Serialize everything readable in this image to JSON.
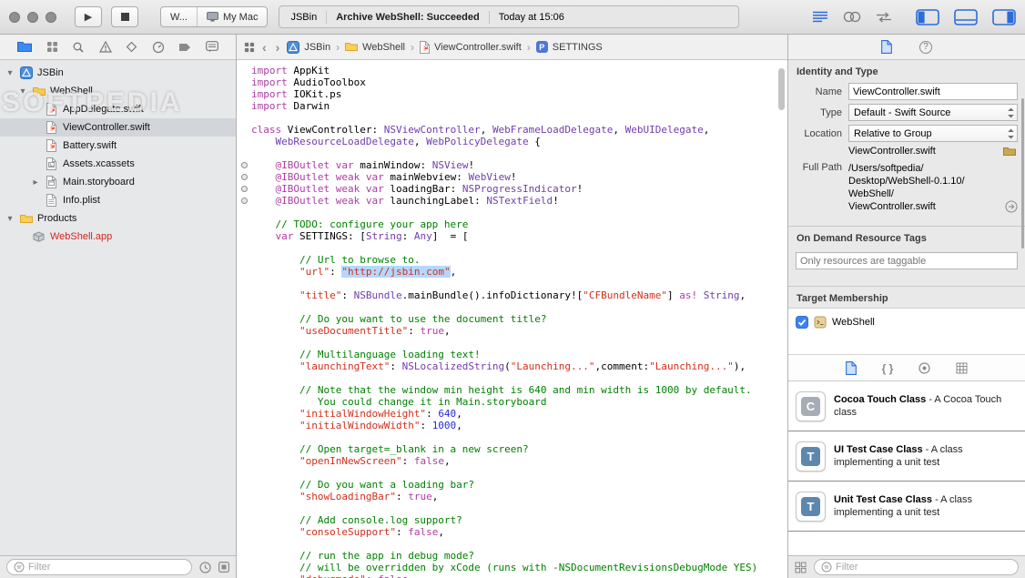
{
  "titlebar": {
    "scheme_label": "W...",
    "destination_label": "My Mac",
    "status_project": "JSBin",
    "status_message": "Archive WebShell: Succeeded",
    "status_time": "Today at 15:06",
    "editor_modes": [
      "standard-editor-icon",
      "assistant-editor-icon",
      "version-editor-icon"
    ],
    "panel_toggles": [
      "toggle-navigator-icon",
      "toggle-debug-area-icon",
      "toggle-utilities-icon"
    ]
  },
  "navigator_tabs": [
    "project-navigator-icon",
    "symbol-navigator-icon",
    "find-navigator-icon",
    "issue-navigator-icon",
    "test-navigator-icon",
    "debug-navigator-icon",
    "breakpoint-navigator-icon",
    "report-navigator-icon"
  ],
  "jumpbar": {
    "crumbs": [
      {
        "icon": "project-icon",
        "label": "JSBin"
      },
      {
        "icon": "folder-icon",
        "label": "WebShell"
      },
      {
        "icon": "swift-file-icon",
        "label": "ViewController.swift"
      },
      {
        "icon": "property-symbol-icon",
        "badge": "P",
        "label": "SETTINGS"
      }
    ]
  },
  "tree": [
    {
      "label": "JSBin",
      "level": 0,
      "icon": "project-icon",
      "disc": "open"
    },
    {
      "label": "WebShell",
      "level": 1,
      "icon": "folder-icon",
      "disc": "open"
    },
    {
      "label": "AppDelegate.swift",
      "level": 2,
      "icon": "swift-file-icon"
    },
    {
      "label": "ViewController.swift",
      "level": 2,
      "icon": "swift-file-icon",
      "selected": true
    },
    {
      "label": "Battery.swift",
      "level": 2,
      "icon": "swift-file-icon"
    },
    {
      "label": "Assets.xcassets",
      "level": 2,
      "icon": "assets-file-icon"
    },
    {
      "label": "Main.storyboard",
      "level": 2,
      "icon": "storyboard-file-icon",
      "disc": "closed"
    },
    {
      "label": "Info.plist",
      "level": 2,
      "icon": "plist-file-icon"
    },
    {
      "label": "Products",
      "level": 0,
      "icon": "folder-icon",
      "disc": "open"
    },
    {
      "label": "WebShell.app",
      "level": 1,
      "icon": "app-icon",
      "missing": true
    }
  ],
  "navigator_filter": {
    "placeholder": "Filter"
  },
  "watermark": "SOFTPEDIA",
  "editor": {
    "lines": [
      {
        "t": [
          [
            "k",
            "import"
          ],
          [
            "p",
            " AppKit"
          ]
        ]
      },
      {
        "t": [
          [
            "k",
            "import"
          ],
          [
            "p",
            " AudioToolbox"
          ]
        ]
      },
      {
        "t": [
          [
            "k",
            "import"
          ],
          [
            "p",
            " IOKit.ps"
          ]
        ]
      },
      {
        "t": [
          [
            "k",
            "import"
          ],
          [
            "p",
            " Darwin"
          ]
        ]
      },
      {
        "t": []
      },
      {
        "t": [
          [
            "k",
            "class"
          ],
          [
            "p",
            " ViewController: "
          ],
          [
            "t",
            "NSViewController"
          ],
          [
            "p",
            ", "
          ],
          [
            "t",
            "WebFrameLoadDelegate"
          ],
          [
            "p",
            ", "
          ],
          [
            "t",
            "WebUIDelegate"
          ],
          [
            "p",
            ","
          ]
        ]
      },
      {
        "t": [
          [
            "p",
            "    "
          ],
          [
            "t",
            "WebResourceLoadDelegate"
          ],
          [
            "p",
            ", "
          ],
          [
            "t",
            "WebPolicyDelegate"
          ],
          [
            "p",
            " {"
          ]
        ]
      },
      {
        "t": []
      },
      {
        "g": 1,
        "t": [
          [
            "p",
            "    "
          ],
          [
            "k",
            "@IBOutlet"
          ],
          [
            "p",
            " "
          ],
          [
            "k",
            "var"
          ],
          [
            "p",
            " mainWindow: "
          ],
          [
            "t",
            "NSView"
          ],
          [
            "p",
            "!"
          ]
        ]
      },
      {
        "g": 1,
        "t": [
          [
            "p",
            "    "
          ],
          [
            "k",
            "@IBOutlet"
          ],
          [
            "p",
            " "
          ],
          [
            "k",
            "weak"
          ],
          [
            "p",
            " "
          ],
          [
            "k",
            "var"
          ],
          [
            "p",
            " mainWebview: "
          ],
          [
            "t",
            "WebView"
          ],
          [
            "p",
            "!"
          ]
        ]
      },
      {
        "g": 1,
        "t": [
          [
            "p",
            "    "
          ],
          [
            "k",
            "@IBOutlet"
          ],
          [
            "p",
            " "
          ],
          [
            "k",
            "weak"
          ],
          [
            "p",
            " "
          ],
          [
            "k",
            "var"
          ],
          [
            "p",
            " loadingBar: "
          ],
          [
            "t",
            "NSProgressIndicator"
          ],
          [
            "p",
            "!"
          ]
        ]
      },
      {
        "g": 1,
        "t": [
          [
            "p",
            "    "
          ],
          [
            "k",
            "@IBOutlet"
          ],
          [
            "p",
            " "
          ],
          [
            "k",
            "weak"
          ],
          [
            "p",
            " "
          ],
          [
            "k",
            "var"
          ],
          [
            "p",
            " launchingLabel: "
          ],
          [
            "t",
            "NSTextField"
          ],
          [
            "p",
            "!"
          ]
        ]
      },
      {
        "t": []
      },
      {
        "t": [
          [
            "p",
            "    "
          ],
          [
            "c",
            "// TODO: configure your app here"
          ]
        ]
      },
      {
        "t": [
          [
            "p",
            "    "
          ],
          [
            "k",
            "var"
          ],
          [
            "p",
            " SETTINGS: ["
          ],
          [
            "t",
            "String"
          ],
          [
            "p",
            ": "
          ],
          [
            "t",
            "Any"
          ],
          [
            "p",
            "]  = ["
          ]
        ]
      },
      {
        "t": []
      },
      {
        "t": [
          [
            "p",
            "        "
          ],
          [
            "c",
            "// Url to browse to."
          ]
        ]
      },
      {
        "t": [
          [
            "p",
            "        "
          ],
          [
            "s",
            "\"url\""
          ],
          [
            "p",
            ": "
          ],
          [
            "hl",
            "\"http://jsbin.com\""
          ],
          [
            "p",
            ","
          ]
        ]
      },
      {
        "t": []
      },
      {
        "t": [
          [
            "p",
            "        "
          ],
          [
            "s",
            "\"title\""
          ],
          [
            "p",
            ": "
          ],
          [
            "t",
            "NSBundle"
          ],
          [
            "p",
            ".mainBundle().infoDictionary!["
          ],
          [
            "s",
            "\"CFBundleName\""
          ],
          [
            "p",
            "] "
          ],
          [
            "k",
            "as!"
          ],
          [
            "p",
            " "
          ],
          [
            "t",
            "String"
          ],
          [
            "p",
            ","
          ]
        ]
      },
      {
        "t": []
      },
      {
        "t": [
          [
            "p",
            "        "
          ],
          [
            "c",
            "// Do you want to use the document title?"
          ]
        ]
      },
      {
        "t": [
          [
            "p",
            "        "
          ],
          [
            "s",
            "\"useDocumentTitle\""
          ],
          [
            "p",
            ": "
          ],
          [
            "k",
            "true"
          ],
          [
            "p",
            ","
          ]
        ]
      },
      {
        "t": []
      },
      {
        "t": [
          [
            "p",
            "        "
          ],
          [
            "c",
            "// Multilanguage loading text!"
          ]
        ]
      },
      {
        "t": [
          [
            "p",
            "        "
          ],
          [
            "s",
            "\"launchingText\""
          ],
          [
            "p",
            ": "
          ],
          [
            "t",
            "NSLocalizedString"
          ],
          [
            "p",
            "("
          ],
          [
            "s",
            "\"Launching...\""
          ],
          [
            "p",
            ",comment:"
          ],
          [
            "s",
            "\"Launching...\""
          ],
          [
            "p",
            "),"
          ]
        ]
      },
      {
        "t": []
      },
      {
        "t": [
          [
            "p",
            "        "
          ],
          [
            "c",
            "// Note that the window min height is 640 and min width is 1000 by default."
          ]
        ]
      },
      {
        "t": [
          [
            "c",
            "           You could change it in Main.storyboard"
          ]
        ]
      },
      {
        "t": [
          [
            "p",
            "        "
          ],
          [
            "s",
            "\"initialWindowHeight\""
          ],
          [
            "p",
            ": "
          ],
          [
            "n",
            "640"
          ],
          [
            "p",
            ","
          ]
        ]
      },
      {
        "t": [
          [
            "p",
            "        "
          ],
          [
            "s",
            "\"initialWindowWidth\""
          ],
          [
            "p",
            ": "
          ],
          [
            "n",
            "1000"
          ],
          [
            "p",
            ","
          ]
        ]
      },
      {
        "t": []
      },
      {
        "t": [
          [
            "p",
            "        "
          ],
          [
            "c",
            "// Open target=_blank in a new screen?"
          ]
        ]
      },
      {
        "t": [
          [
            "p",
            "        "
          ],
          [
            "s",
            "\"openInNewScreen\""
          ],
          [
            "p",
            ": "
          ],
          [
            "k",
            "false"
          ],
          [
            "p",
            ","
          ]
        ]
      },
      {
        "t": []
      },
      {
        "t": [
          [
            "p",
            "        "
          ],
          [
            "c",
            "// Do you want a loading bar?"
          ]
        ]
      },
      {
        "t": [
          [
            "p",
            "        "
          ],
          [
            "s",
            "\"showLoadingBar\""
          ],
          [
            "p",
            ": "
          ],
          [
            "k",
            "true"
          ],
          [
            "p",
            ","
          ]
        ]
      },
      {
        "t": []
      },
      {
        "t": [
          [
            "p",
            "        "
          ],
          [
            "c",
            "// Add console.log support?"
          ]
        ]
      },
      {
        "t": [
          [
            "p",
            "        "
          ],
          [
            "s",
            "\"consoleSupport\""
          ],
          [
            "p",
            ": "
          ],
          [
            "k",
            "false"
          ],
          [
            "p",
            ","
          ]
        ]
      },
      {
        "t": []
      },
      {
        "t": [
          [
            "p",
            "        "
          ],
          [
            "c",
            "// run the app in debug mode?"
          ]
        ]
      },
      {
        "t": [
          [
            "p",
            "        "
          ],
          [
            "c",
            "// will be overridden by xCode (runs with -NSDocumentRevisionsDebugMode YES)"
          ]
        ]
      },
      {
        "t": [
          [
            "p",
            "        "
          ],
          [
            "s",
            "\"debugmode\""
          ],
          [
            "p",
            ": "
          ],
          [
            "k",
            "false"
          ],
          [
            "p",
            ","
          ]
        ]
      }
    ]
  },
  "inspector": {
    "tabs": [
      "file-inspector-icon",
      "quick-help-icon"
    ],
    "identity_header": "Identity and Type",
    "name_label": "Name",
    "name_value": "ViewController.swift",
    "type_label": "Type",
    "type_value": "Default - Swift Source",
    "location_label": "Location",
    "location_value": "Relative to Group",
    "location_file": "ViewController.swift",
    "fullpath_label": "Full Path",
    "fullpath_lines": [
      "/Users/softpedia/",
      "Desktop/WebShell-0.1.10/",
      "WebShell/",
      "ViewController.swift"
    ],
    "odr_header": "On Demand Resource Tags",
    "odr_placeholder": "Only resources are taggable",
    "target_header": "Target Membership",
    "targets": [
      {
        "label": "WebShell",
        "checked": true
      }
    ]
  },
  "library": {
    "tabs": [
      "file-template-library-icon",
      "code-snippet-library-icon",
      "object-library-icon",
      "media-library-icon"
    ],
    "items": [
      {
        "badge": "C",
        "badge_style": "gray",
        "title": "Cocoa Touch Class",
        "desc": " - A Cocoa Touch class"
      },
      {
        "badge": "T",
        "badge_style": "blue",
        "title": "UI Test Case Class",
        "desc": " - A class implementing a unit test"
      },
      {
        "badge": "T",
        "badge_style": "blue",
        "title": "Unit Test Case Class",
        "desc": " - A class implementing a unit test"
      }
    ],
    "filter_placeholder": "Filter"
  }
}
